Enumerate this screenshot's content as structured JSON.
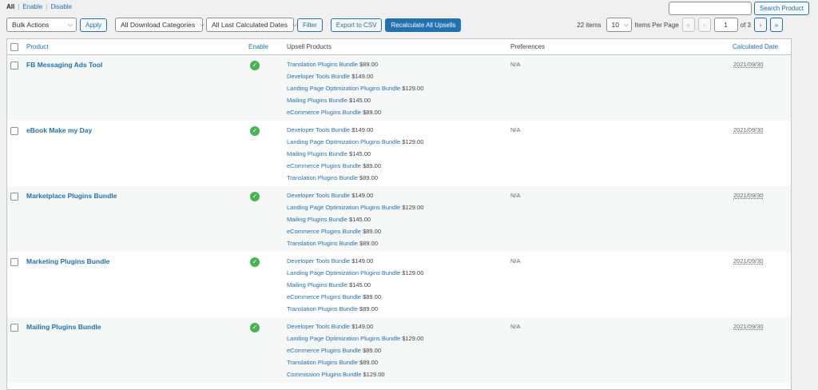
{
  "filters": {
    "all": "All",
    "enable": "Enable",
    "disable": "Disable",
    "separator": "|"
  },
  "search": {
    "button": "Search Product",
    "value": ""
  },
  "toolbar": {
    "bulk_actions": "Bulk Actions",
    "apply": "Apply",
    "categories": "All Download Categories",
    "dates": "All Last Calculated Dates",
    "filter": "Filter",
    "export": "Export to CSV",
    "recalculate": "Recalculate All Upsells"
  },
  "pagination": {
    "items": "22 items",
    "per_page_value": "10",
    "per_page_label": "Items Per Page",
    "first": "«",
    "prev": "‹",
    "current_page": "1",
    "of_total": "of 3",
    "next": "›",
    "last": "»"
  },
  "table": {
    "headers": {
      "product": "Product",
      "enable": "Enable",
      "upsells": "Upsell Products",
      "preferences": "Preferences",
      "date": "Calculated Date"
    },
    "rows": [
      {
        "product": "FB Messaging Ads Tool",
        "preferences": "N/A",
        "date": "2021/09/30",
        "upsells": [
          {
            "name": "Translation Plugins Bundle",
            "price": "$89.00"
          },
          {
            "name": "Developer Tools Bundle",
            "price": "$149.00"
          },
          {
            "name": "Landing Page Optimization Plugins Bundle",
            "price": "$129.00"
          },
          {
            "name": "Mailing Plugins Bundle",
            "price": "$145.00"
          },
          {
            "name": "eCommerce Plugins Bundle",
            "price": "$89.00"
          }
        ]
      },
      {
        "product": "eBook Make my Day",
        "preferences": "N/A",
        "date": "2021/09/30",
        "upsells": [
          {
            "name": "Developer Tools Bundle",
            "price": "$149.00"
          },
          {
            "name": "Landing Page Optimization Plugins Bundle",
            "price": "$129.00"
          },
          {
            "name": "Mailing Plugins Bundle",
            "price": "$145.00"
          },
          {
            "name": "eCommerce Plugins Bundle",
            "price": "$89.00"
          },
          {
            "name": "Translation Plugins Bundle",
            "price": "$89.00"
          }
        ]
      },
      {
        "product": "Marketplace Plugins Bundle",
        "preferences": "N/A",
        "date": "2021/09/30",
        "upsells": [
          {
            "name": "Developer Tools Bundle",
            "price": "$149.00"
          },
          {
            "name": "Landing Page Optimization Plugins Bundle",
            "price": "$129.00"
          },
          {
            "name": "Mailing Plugins Bundle",
            "price": "$145.00"
          },
          {
            "name": "eCommerce Plugins Bundle",
            "price": "$89.00"
          },
          {
            "name": "Translation Plugins Bundle",
            "price": "$89.00"
          }
        ]
      },
      {
        "product": "Marketing Plugins Bundle",
        "preferences": "N/A",
        "date": "2021/09/30",
        "upsells": [
          {
            "name": "Developer Tools Bundle",
            "price": "$149.00"
          },
          {
            "name": "Landing Page Optimization Plugins Bundle",
            "price": "$129.00"
          },
          {
            "name": "Mailing Plugins Bundle",
            "price": "$145.00"
          },
          {
            "name": "eCommerce Plugins Bundle",
            "price": "$89.00"
          },
          {
            "name": "Translation Plugins Bundle",
            "price": "$89.00"
          }
        ]
      },
      {
        "product": "Mailing Plugins Bundle",
        "preferences": "N/A",
        "date": "2021/09/30",
        "upsells": [
          {
            "name": "Developer Tools Bundle",
            "price": "$149.00"
          },
          {
            "name": "Landing Page Optimization Plugins Bundle",
            "price": "$129.00"
          },
          {
            "name": "eCommerce Plugins Bundle",
            "price": "$89.00"
          },
          {
            "name": "Translation Plugins Bundle",
            "price": "$89.00"
          },
          {
            "name": "Commission Plugins Bundle",
            "price": "$129.00"
          }
        ]
      }
    ]
  }
}
